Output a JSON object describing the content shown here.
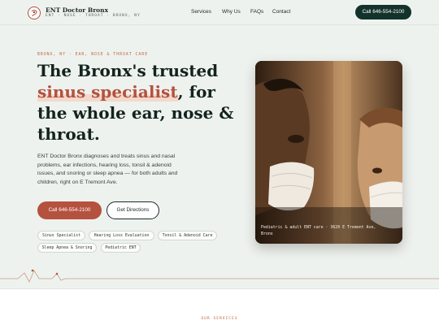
{
  "header": {
    "brand_name": "ENT Doctor Bronx",
    "brand_tag": "ENT · NOSE · THROAT · BRONX, NY",
    "nav": [
      "Services",
      "Why Us",
      "FAQs",
      "Contact"
    ],
    "call_label": "Call 646-554-2100"
  },
  "hero": {
    "eyebrow": "BRONX, NY · EAR, NOSE & THROAT CARE",
    "title_line1": "The Bronx's trusted",
    "title_accent": "sinus specialist",
    "title_after_accent": ", for",
    "title_line3": "the whole ear, nose &",
    "title_line4": "throat.",
    "description_lines": [
      "ENT Doctor Bronx diagnoses and treats sinus and nasal",
      "problems, ear infections, hearing loss, tonsil & adenoid",
      "issues, and snoring or sleep apnea — for both adults and",
      "children, right on E Tremont Ave."
    ],
    "cta_call": "Call 646-554-2100",
    "cta_directions": "Get Directions",
    "tags": [
      "Sinus Specialist",
      "Hearing Loss Evaluation",
      "Tonsil & Adenoid Care",
      "Sleep Apnea & Snoring",
      "Pediatric ENT"
    ],
    "photo_caption_line1": "Pediatric & adult ENT care · 3620 E Tremont Ave,",
    "photo_caption_line2": "Bronx"
  },
  "services": {
    "eyebrow": "OUR SERVICES"
  },
  "colors": {
    "accent": "#b5513f",
    "dark": "#13322b",
    "background": "#eef2ee"
  }
}
